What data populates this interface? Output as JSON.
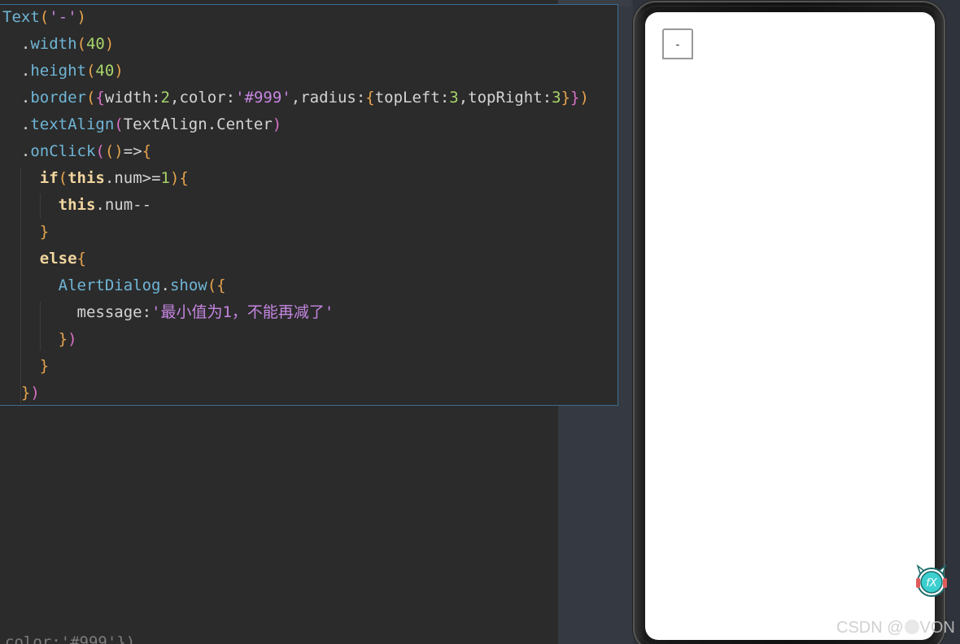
{
  "code": {
    "lines": [
      {
        "segments": [
          {
            "t": "Text",
            "c": "c-fn"
          },
          {
            "t": "(",
            "c": "c-paren1"
          },
          {
            "t": "'-'",
            "c": "c-str"
          },
          {
            "t": ")",
            "c": "c-paren1"
          }
        ]
      },
      {
        "segments": [
          {
            "t": "  .",
            "c": "c-plain"
          },
          {
            "t": "width",
            "c": "c-fn"
          },
          {
            "t": "(",
            "c": "c-paren1"
          },
          {
            "t": "40",
            "c": "c-num"
          },
          {
            "t": ")",
            "c": "c-paren1"
          }
        ]
      },
      {
        "segments": [
          {
            "t": "  .",
            "c": "c-plain"
          },
          {
            "t": "height",
            "c": "c-fn"
          },
          {
            "t": "(",
            "c": "c-paren1"
          },
          {
            "t": "40",
            "c": "c-num"
          },
          {
            "t": ")",
            "c": "c-paren1"
          }
        ]
      },
      {
        "segments": [
          {
            "t": "  .",
            "c": "c-plain"
          },
          {
            "t": "border",
            "c": "c-fn"
          },
          {
            "t": "(",
            "c": "c-paren1"
          },
          {
            "t": "{",
            "c": "c-paren2"
          },
          {
            "t": "width",
            "c": "c-prop"
          },
          {
            "t": ":",
            "c": "c-plain"
          },
          {
            "t": "2",
            "c": "c-num"
          },
          {
            "t": ",",
            "c": "c-plain"
          },
          {
            "t": "color",
            "c": "c-prop"
          },
          {
            "t": ":",
            "c": "c-plain"
          },
          {
            "t": "'#999'",
            "c": "c-str"
          },
          {
            "t": ",",
            "c": "c-plain"
          },
          {
            "t": "radius",
            "c": "c-prop"
          },
          {
            "t": ":",
            "c": "c-plain"
          },
          {
            "t": "{",
            "c": "c-paren1"
          },
          {
            "t": "topLeft",
            "c": "c-prop"
          },
          {
            "t": ":",
            "c": "c-plain"
          },
          {
            "t": "3",
            "c": "c-num"
          },
          {
            "t": ",",
            "c": "c-plain"
          },
          {
            "t": "topRight",
            "c": "c-prop"
          },
          {
            "t": ":",
            "c": "c-plain"
          },
          {
            "t": "3",
            "c": "c-num"
          },
          {
            "t": "}",
            "c": "c-paren1"
          },
          {
            "t": "}",
            "c": "c-paren2"
          },
          {
            "t": ")",
            "c": "c-paren1"
          }
        ]
      },
      {
        "segments": [
          {
            "t": "  .",
            "c": "c-plain"
          },
          {
            "t": "textAlign",
            "c": "c-fn"
          },
          {
            "t": "(",
            "c": "c-paren2"
          },
          {
            "t": "TextAlign",
            "c": "c-type"
          },
          {
            "t": ".",
            "c": "c-plain"
          },
          {
            "t": "Center",
            "c": "c-prop"
          },
          {
            "t": ")",
            "c": "c-paren2"
          }
        ]
      },
      {
        "segments": [
          {
            "t": "  .",
            "c": "c-plain"
          },
          {
            "t": "onClick",
            "c": "c-fn"
          },
          {
            "t": "(",
            "c": "c-paren2"
          },
          {
            "t": "()",
            "c": "c-paren1"
          },
          {
            "t": "=>",
            "c": "c-plain"
          },
          {
            "t": "{",
            "c": "c-paren1"
          }
        ]
      },
      {
        "segments": [
          {
            "t": "    ",
            "c": "c-plain"
          },
          {
            "t": "if",
            "c": "c-kw"
          },
          {
            "t": "(",
            "c": "c-paren1"
          },
          {
            "t": "this",
            "c": "c-kw"
          },
          {
            "t": ".num>=",
            "c": "c-plain"
          },
          {
            "t": "1",
            "c": "c-num"
          },
          {
            "t": ")",
            "c": "c-paren1"
          },
          {
            "t": "{",
            "c": "c-paren1"
          }
        ]
      },
      {
        "segments": [
          {
            "t": "      ",
            "c": "c-plain"
          },
          {
            "t": "this",
            "c": "c-kw"
          },
          {
            "t": ".num--",
            "c": "c-plain"
          }
        ]
      },
      {
        "segments": [
          {
            "t": "    ",
            "c": "c-plain"
          },
          {
            "t": "}",
            "c": "c-paren1"
          }
        ]
      },
      {
        "segments": [
          {
            "t": "    ",
            "c": "c-plain"
          },
          {
            "t": "else",
            "c": "c-kw"
          },
          {
            "t": "{",
            "c": "c-paren1"
          }
        ]
      },
      {
        "segments": [
          {
            "t": "      ",
            "c": "c-plain"
          },
          {
            "t": "AlertDialog",
            "c": "c-fn"
          },
          {
            "t": ".",
            "c": "c-plain"
          },
          {
            "t": "show",
            "c": "c-fn"
          },
          {
            "t": "(",
            "c": "c-paren1"
          },
          {
            "t": "{",
            "c": "c-paren1"
          }
        ]
      },
      {
        "segments": [
          {
            "t": "        message",
            "c": "c-prop"
          },
          {
            "t": ":",
            "c": "c-plain"
          },
          {
            "t": "'最小值为1，不能再减了'",
            "c": "c-str"
          }
        ]
      },
      {
        "segments": [
          {
            "t": "      ",
            "c": "c-plain"
          },
          {
            "t": "}",
            "c": "c-paren1"
          },
          {
            "t": ")",
            "c": "c-paren2"
          }
        ]
      },
      {
        "segments": [
          {
            "t": "    ",
            "c": "c-plain"
          },
          {
            "t": "}",
            "c": "c-paren1"
          }
        ]
      },
      {
        "segments": [
          {
            "t": "  ",
            "c": "c-plain"
          },
          {
            "t": "}",
            "c": "c-paren1"
          },
          {
            "t": ")",
            "c": "c-paren2"
          }
        ]
      }
    ]
  },
  "background_fragment": "color:'#999'})",
  "preview": {
    "button_label": "-"
  },
  "watermark": {
    "prefix": "CSDN @",
    "suffix": "VON"
  },
  "mascot": {
    "icon": "fx-mascot-icon",
    "label": "fX"
  },
  "colors": {
    "editor_bg": "#2b2b2b",
    "popup_border": "#3d6d93",
    "screen_bg": "#ffffff",
    "button_border": "#999999"
  }
}
